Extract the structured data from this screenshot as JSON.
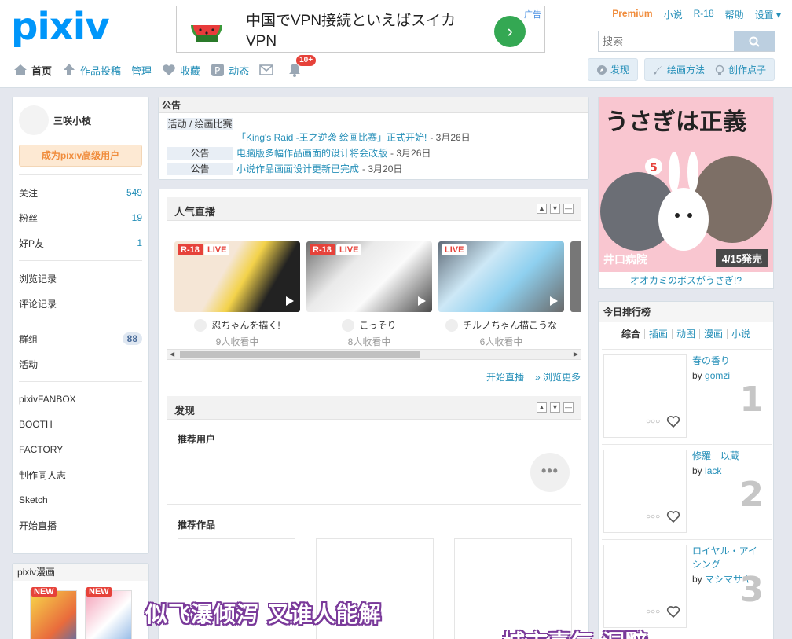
{
  "header": {
    "logo": "pixiv",
    "ad": {
      "text": "中国でVPN接続といえばスイカVPN",
      "tag": "广告",
      "icon": "watermelon-icon"
    },
    "toplinks": {
      "premium": "Premium",
      "novel": "小说",
      "r18": "R-18",
      "help": "帮助",
      "settings": "设置 ▾"
    },
    "search": {
      "placeholder": "搜索"
    },
    "nav": {
      "home": "首页",
      "upload": "作品投稿",
      "manage": "管理",
      "bookmarks": "收藏",
      "feed": "动态",
      "notifications_badge": "10+"
    },
    "nav_right": {
      "discover": "发现",
      "howto": "绘画方法",
      "ideas": "创作点子"
    }
  },
  "sidebar": {
    "username": "三咲小枝",
    "premium_button": "成为pixiv高级用户",
    "stats": [
      {
        "label": "关注",
        "value": "549"
      },
      {
        "label": "粉丝",
        "value": "19"
      },
      {
        "label": "好P友",
        "value": "1"
      }
    ],
    "history": [
      "浏览记录",
      "评论记录"
    ],
    "groups": {
      "label": "群组",
      "count": "88"
    },
    "activity": "活动",
    "services": [
      "pixivFANBOX",
      "BOOTH",
      "FACTORY",
      "制作同人志",
      "Sketch",
      "开始直播"
    ],
    "manga_title": "pixiv漫画",
    "manga_new": "NEW"
  },
  "announce": {
    "title": "公告",
    "items": [
      {
        "category": "活动 / 绘画比赛",
        "text": "「King's Raid -王之逆袭 绘画比赛」正式开始!",
        "date": "- 3月26日"
      },
      {
        "category": "公告",
        "text": "电脑版多幅作品画面的设计将会改版",
        "date": "- 3月26日"
      },
      {
        "category": "公告",
        "text": "小说作品画面设计更新已完成",
        "date": "- 3月20日"
      }
    ]
  },
  "live": {
    "title": "人气直播",
    "cards": [
      {
        "r18": "R-18",
        "live": "LIVE",
        "title": "忍ちゃんを描く!",
        "viewers": "9人收看中"
      },
      {
        "r18": "R-18",
        "live": "LIVE",
        "title": "こっそり",
        "viewers": "8人收看中"
      },
      {
        "r18": "",
        "live": "LIVE",
        "title": "チルノちゃん描こうな",
        "viewers": "6人收看中"
      }
    ],
    "start": "开始直播",
    "more": "» 浏览更多"
  },
  "discover": {
    "title": "发现",
    "users": "推荐用户",
    "works": "推荐作品",
    "more_dots": "•••"
  },
  "right": {
    "ad_title": "うさぎは正義",
    "ad_author": "井口病院",
    "ad_date": "4/15発売",
    "ad_caption": "オオカミのボスがうさぎ!?",
    "ranking_title": "今日排行榜",
    "tabs": [
      "综合",
      "插画",
      "动图",
      "漫画",
      "小说"
    ],
    "items": [
      {
        "title": "春の香り",
        "by": "by",
        "author": "gomzi",
        "rank": "1"
      },
      {
        "title": "修羅　以蔵",
        "by": "by",
        "author": "lack",
        "rank": "2"
      },
      {
        "title": "ロイヤル・アイシング",
        "by": "by",
        "author": "マシマサキ",
        "rank": "3"
      }
    ],
    "dots": "○○○"
  },
  "overlay": {
    "caption": "似飞瀑倾泻 又谁人能解",
    "caption2": "城市喜气 洞黯"
  },
  "colors": {
    "accent": "#0096fa",
    "link": "#258fb8",
    "premium": "#f08c3c",
    "badge": "#e6423a"
  }
}
